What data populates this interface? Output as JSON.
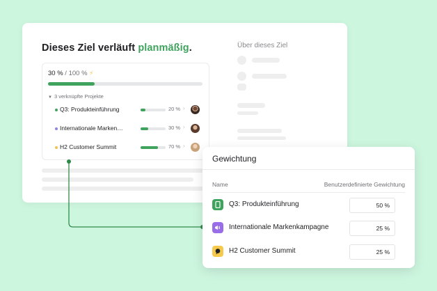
{
  "goal": {
    "title_prefix": "Dieses Ziel verläuft",
    "status_word": "planmäßig",
    "title_suffix": ".",
    "about_title": "Über dieses Ziel",
    "progress_current": "30 %",
    "progress_separator": " / ",
    "progress_target": "100 %",
    "progress_value": 0.3,
    "bolt_icon": "⚡",
    "linked_projects_label": "3 verknüpfte Projekte",
    "projects": [
      {
        "name": "Q3: Produkteinführung",
        "percent": "20 %",
        "progress": 0.2,
        "dot_color": "#3fa35d",
        "avatar_icon": "person-avatar"
      },
      {
        "name": "Internationale Marken…",
        "percent": "30 %",
        "progress": 0.3,
        "dot_color": "#8d84e8",
        "avatar_icon": "person-avatar"
      },
      {
        "name": "H2 Customer Summit",
        "percent": "70 %",
        "progress": 0.7,
        "dot_color": "#f0c44c",
        "avatar_icon": "person-avatar"
      }
    ]
  },
  "weighting": {
    "title": "Gewichtung",
    "col_name": "Name",
    "col_weight": "Benutzerdefinierte Gewichtung",
    "rows": [
      {
        "name": "Q3: Produkteinführung",
        "weight": "50 %",
        "icon_color": "#3fa35d",
        "icon_name": "phone-icon"
      },
      {
        "name": "Internationale Markenkampagne",
        "weight": "25 %",
        "icon_color": "#9a6de8",
        "icon_name": "megaphone-icon"
      },
      {
        "name": "H2 Customer Summit",
        "weight": "25 %",
        "icon_color": "#f6c94e",
        "icon_name": "speech-bubble-icon"
      }
    ]
  },
  "colors": {
    "accent": "#3fa35d",
    "background": "#cdf6df"
  }
}
